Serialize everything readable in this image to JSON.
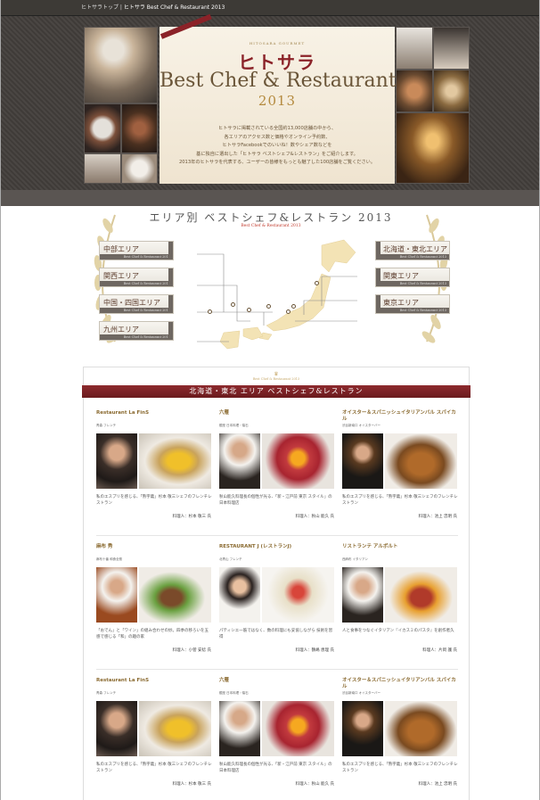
{
  "breadcrumb": {
    "home": "ヒトサラトップ",
    "separator": " | ",
    "current": "ヒトサラ Best Chef & Restaurant 2013"
  },
  "hero": {
    "logo_small": "HITOSARA GOURMET",
    "logo": "ヒトサラ",
    "title": "Best Chef & Restaurant",
    "year": "2013",
    "description": [
      "ヒトサラに掲載されている全国約13,000店舗の中から、",
      "各エリアのアクセス数と価格やオンライン予約数、",
      "ヒトサラFacebookでのいいね！数やシェア数などを",
      "基に独自に選出した「ヒトサラ ベストシェフ&レストラン」をご紹介します。",
      "2013年のヒトサラを代表する、ユーザーの皆様をもっとも魅了した100店舗をご覧ください。"
    ]
  },
  "map": {
    "title": "エリア別 ベストシェフ&レストラン 2013",
    "subtitle": "Best Chef & Restaurant 2013",
    "region_sub": "Best Chef & Restaurant 2013",
    "regions_left": [
      "中部エリア",
      "関西エリア",
      "中国・四国エリア",
      "九州エリア"
    ],
    "regions_right": [
      "北海道・東北エリア",
      "関東エリア",
      "東京エリア"
    ]
  },
  "section": {
    "crest": "♛",
    "crest_sub": "Best Chef & Restaurant 2013",
    "heading": "北海道・東北 エリア ベストシェフ&レストラン"
  },
  "cards": [
    {
      "name": "Restaurant La FinS",
      "genre": "青森 フレンチ",
      "desc": "私のエスプリを感じる、「熟宇義」杉本 敬三シェフのフレンチレストラン",
      "chef": "料理人：杉本 敬三 氏"
    },
    {
      "name": "六雁",
      "genre": "銀座 日本料理・懐石",
      "desc": "秋山能久料理長の個性が光る、「新・江戸前 東京 スタイル」の日本料理店",
      "chef": "料理人：秋山 能久 氏"
    },
    {
      "name": "オイスター＆スパニッシュイタリアンバル スパイカル",
      "genre": "渋谷新南口 オイスターバー",
      "desc": "私のエスプリを感じる、「熟宇義」杉本 敬三シェフのフレンチレストラン",
      "chef": "料理人：池上 忠明 氏"
    },
    {
      "name": "麻布 秀",
      "genre": "麻布十番 和食全般",
      "desc": "「おでん」と「ワイン」の組み合わせの妙。四季の移ろいを五感で感じる「和」の趣の家",
      "chef": "料理人：小菅 安稔 氏"
    },
    {
      "name": "RESTAURANT J (レストランJ)",
      "genre": "北青山 フレンチ",
      "desc": "パティシエ一筋ではなく、数の料理にも妥協しながら 技術を習得",
      "chef": "料理人：鶴嶋 恵理 氏"
    },
    {
      "name": "リストランテ アルポルト",
      "genre": "西麻布 イタリアン",
      "desc": "人と食事をつなぐイタリアン『イカスミのパスタ』を創作者久",
      "chef": "料理人：片岡 護 氏"
    },
    {
      "name": "Restaurant La FinS",
      "genre": "青森 フレンチ",
      "desc": "私のエスプリを感じる、「熟宇義」杉本 敬三シェフのフレンチレストラン",
      "chef": "料理人：杉本 敬三 氏"
    },
    {
      "name": "六雁",
      "genre": "銀座 日本料理・懐石",
      "desc": "秋山能久料理長の個性が光る、「新・江戸前 東京 スタイル」の日本料理店",
      "chef": "料理人：秋山 能久 氏"
    },
    {
      "name": "オイスター＆スパニッシュイタリアンバル スパイカル",
      "genre": "渋谷新南口 オイスターバー",
      "desc": "私のエスプリを感じる、「熟宇義」杉本 敬三シェフのフレンチレストラン",
      "chef": "料理人：池上 忠明 氏"
    }
  ]
}
